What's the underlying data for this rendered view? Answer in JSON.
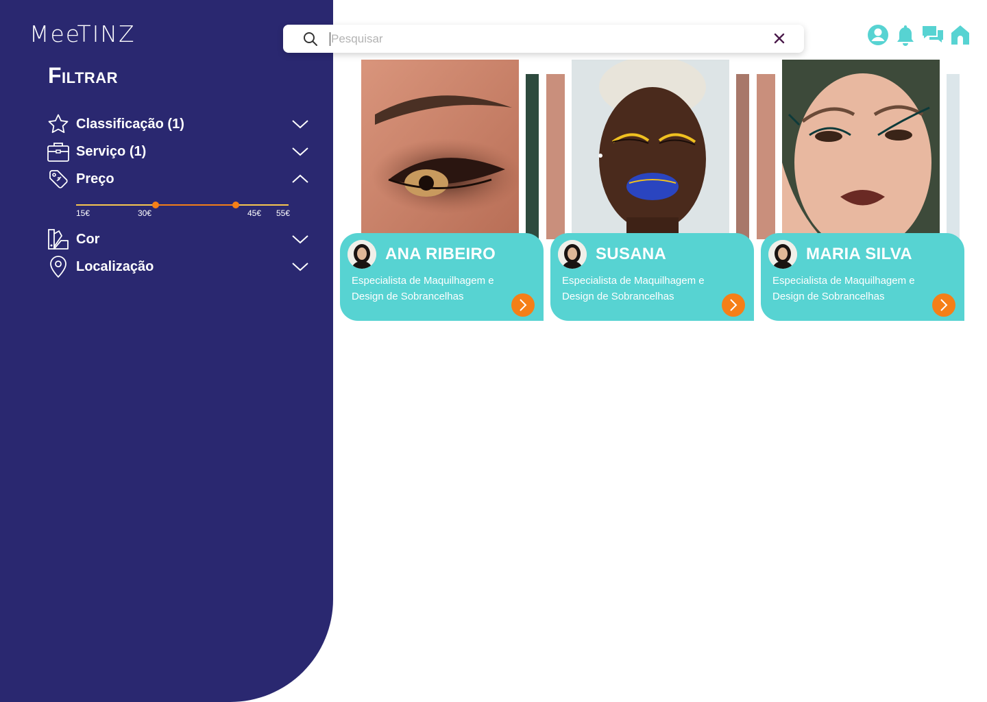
{
  "app": {
    "logo": "MeeTINZ"
  },
  "sidebar": {
    "title": "Filtrar",
    "filters": [
      {
        "label": "Classificação (1)",
        "icon": "star-icon",
        "expanded": false
      },
      {
        "label": "Serviço (1)",
        "icon": "briefcase-icon",
        "expanded": false
      },
      {
        "label": "Preço",
        "icon": "price-tag-icon",
        "expanded": true
      },
      {
        "label": "Cor",
        "icon": "color-swatch-icon",
        "expanded": false
      },
      {
        "label": "Localização",
        "icon": "location-pin-icon",
        "expanded": false
      }
    ],
    "price_slider": {
      "min_label": "15€",
      "low_label": "30€",
      "high_label": "45€",
      "max_label": "55€",
      "min": 15,
      "max": 55,
      "low": 30,
      "high": 45
    }
  },
  "search": {
    "placeholder": "Pesquisar",
    "value": ""
  },
  "top_icons": [
    "user-profile-icon",
    "bell-icon",
    "chat-icon",
    "home-icon"
  ],
  "cards": [
    {
      "name": "ANA RIBEIRO",
      "description": "Especialista de Maquilhagem e Design de Sobrancelhas"
    },
    {
      "name": "SUSANA",
      "description": "Especialista de Maquilhagem e Design de Sobrancelhas"
    },
    {
      "name": "MARIA SILVA",
      "description": "Especialista de Maquilhagem e Design de Sobrancelhas"
    }
  ],
  "colors": {
    "sidebar": "#2a2870",
    "accent_teal": "#57d3d2",
    "accent_orange": "#f57f17",
    "slider_track": "#f9c74f"
  }
}
